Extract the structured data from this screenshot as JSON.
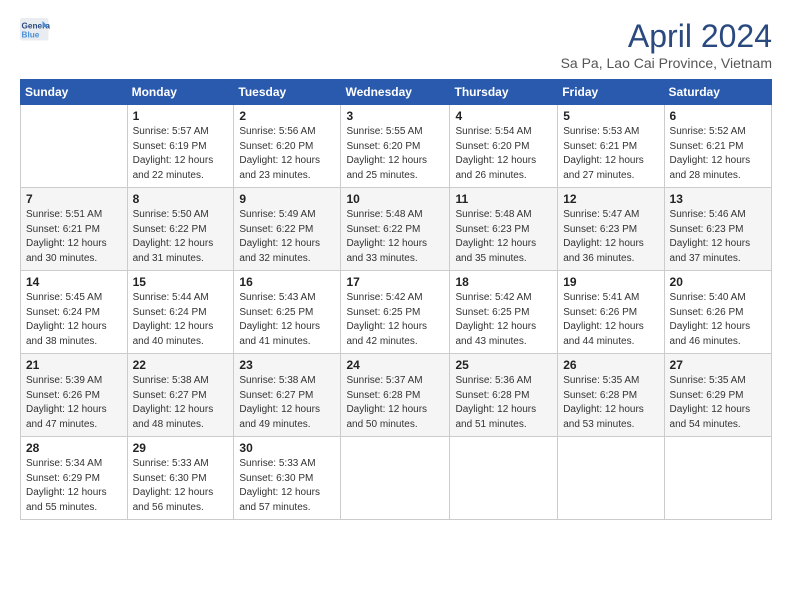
{
  "header": {
    "logo_line1": "General",
    "logo_line2": "Blue",
    "title": "April 2024",
    "subtitle": "Sa Pa, Lao Cai Province, Vietnam"
  },
  "days_of_week": [
    "Sunday",
    "Monday",
    "Tuesday",
    "Wednesday",
    "Thursday",
    "Friday",
    "Saturday"
  ],
  "weeks": [
    [
      {
        "day": "",
        "info": ""
      },
      {
        "day": "1",
        "info": "Sunrise: 5:57 AM\nSunset: 6:19 PM\nDaylight: 12 hours\nand 22 minutes."
      },
      {
        "day": "2",
        "info": "Sunrise: 5:56 AM\nSunset: 6:20 PM\nDaylight: 12 hours\nand 23 minutes."
      },
      {
        "day": "3",
        "info": "Sunrise: 5:55 AM\nSunset: 6:20 PM\nDaylight: 12 hours\nand 25 minutes."
      },
      {
        "day": "4",
        "info": "Sunrise: 5:54 AM\nSunset: 6:20 PM\nDaylight: 12 hours\nand 26 minutes."
      },
      {
        "day": "5",
        "info": "Sunrise: 5:53 AM\nSunset: 6:21 PM\nDaylight: 12 hours\nand 27 minutes."
      },
      {
        "day": "6",
        "info": "Sunrise: 5:52 AM\nSunset: 6:21 PM\nDaylight: 12 hours\nand 28 minutes."
      }
    ],
    [
      {
        "day": "7",
        "info": "Sunrise: 5:51 AM\nSunset: 6:21 PM\nDaylight: 12 hours\nand 30 minutes."
      },
      {
        "day": "8",
        "info": "Sunrise: 5:50 AM\nSunset: 6:22 PM\nDaylight: 12 hours\nand 31 minutes."
      },
      {
        "day": "9",
        "info": "Sunrise: 5:49 AM\nSunset: 6:22 PM\nDaylight: 12 hours\nand 32 minutes."
      },
      {
        "day": "10",
        "info": "Sunrise: 5:48 AM\nSunset: 6:22 PM\nDaylight: 12 hours\nand 33 minutes."
      },
      {
        "day": "11",
        "info": "Sunrise: 5:48 AM\nSunset: 6:23 PM\nDaylight: 12 hours\nand 35 minutes."
      },
      {
        "day": "12",
        "info": "Sunrise: 5:47 AM\nSunset: 6:23 PM\nDaylight: 12 hours\nand 36 minutes."
      },
      {
        "day": "13",
        "info": "Sunrise: 5:46 AM\nSunset: 6:23 PM\nDaylight: 12 hours\nand 37 minutes."
      }
    ],
    [
      {
        "day": "14",
        "info": "Sunrise: 5:45 AM\nSunset: 6:24 PM\nDaylight: 12 hours\nand 38 minutes."
      },
      {
        "day": "15",
        "info": "Sunrise: 5:44 AM\nSunset: 6:24 PM\nDaylight: 12 hours\nand 40 minutes."
      },
      {
        "day": "16",
        "info": "Sunrise: 5:43 AM\nSunset: 6:25 PM\nDaylight: 12 hours\nand 41 minutes."
      },
      {
        "day": "17",
        "info": "Sunrise: 5:42 AM\nSunset: 6:25 PM\nDaylight: 12 hours\nand 42 minutes."
      },
      {
        "day": "18",
        "info": "Sunrise: 5:42 AM\nSunset: 6:25 PM\nDaylight: 12 hours\nand 43 minutes."
      },
      {
        "day": "19",
        "info": "Sunrise: 5:41 AM\nSunset: 6:26 PM\nDaylight: 12 hours\nand 44 minutes."
      },
      {
        "day": "20",
        "info": "Sunrise: 5:40 AM\nSunset: 6:26 PM\nDaylight: 12 hours\nand 46 minutes."
      }
    ],
    [
      {
        "day": "21",
        "info": "Sunrise: 5:39 AM\nSunset: 6:26 PM\nDaylight: 12 hours\nand 47 minutes."
      },
      {
        "day": "22",
        "info": "Sunrise: 5:38 AM\nSunset: 6:27 PM\nDaylight: 12 hours\nand 48 minutes."
      },
      {
        "day": "23",
        "info": "Sunrise: 5:38 AM\nSunset: 6:27 PM\nDaylight: 12 hours\nand 49 minutes."
      },
      {
        "day": "24",
        "info": "Sunrise: 5:37 AM\nSunset: 6:28 PM\nDaylight: 12 hours\nand 50 minutes."
      },
      {
        "day": "25",
        "info": "Sunrise: 5:36 AM\nSunset: 6:28 PM\nDaylight: 12 hours\nand 51 minutes."
      },
      {
        "day": "26",
        "info": "Sunrise: 5:35 AM\nSunset: 6:28 PM\nDaylight: 12 hours\nand 53 minutes."
      },
      {
        "day": "27",
        "info": "Sunrise: 5:35 AM\nSunset: 6:29 PM\nDaylight: 12 hours\nand 54 minutes."
      }
    ],
    [
      {
        "day": "28",
        "info": "Sunrise: 5:34 AM\nSunset: 6:29 PM\nDaylight: 12 hours\nand 55 minutes."
      },
      {
        "day": "29",
        "info": "Sunrise: 5:33 AM\nSunset: 6:30 PM\nDaylight: 12 hours\nand 56 minutes."
      },
      {
        "day": "30",
        "info": "Sunrise: 5:33 AM\nSunset: 6:30 PM\nDaylight: 12 hours\nand 57 minutes."
      },
      {
        "day": "",
        "info": ""
      },
      {
        "day": "",
        "info": ""
      },
      {
        "day": "",
        "info": ""
      },
      {
        "day": "",
        "info": ""
      }
    ]
  ]
}
